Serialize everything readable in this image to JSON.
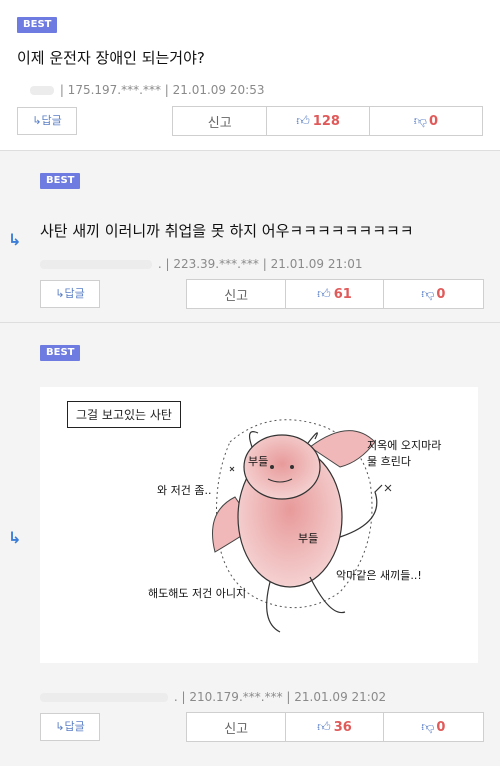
{
  "comments": [
    {
      "badge": "BEST",
      "text": "이제 운전자 장애인 되는거야?",
      "ip": "| 175.197.***.***",
      "datetime": "| 21.01.09 20:53",
      "reply_label": "↳답글",
      "report_label": "신고",
      "likes": "128",
      "dislikes": "0"
    },
    {
      "badge": "BEST",
      "text": "사탄 새끼 이러니까 취업을 못 하지 어우ㅋㅋㅋㅋㅋㅋㅋㅋㅋ",
      "ip": ". | 223.39.***.***",
      "datetime": "| 21.01.09 21:01",
      "reply_label": "↳답글",
      "report_label": "신고",
      "likes": "61",
      "dislikes": "0"
    },
    {
      "badge": "BEST",
      "image": {
        "caption": "그걸 보고있는 사탄",
        "texts": {
          "budeul1": "부들",
          "budeul2": "부들",
          "wajeogeon": "와 저건 좀..",
          "haedo": "해도해도 저건 아니지",
          "jiok": "지옥에 오지마라",
          "mul": "물 흐린다",
          "akma": "악마같은 새끼들..!"
        }
      },
      "ip": ". | 210.179.***.***",
      "datetime": "| 21.01.09 21:02",
      "reply_label": "↳답글",
      "report_label": "신고",
      "likes": "36",
      "dislikes": "0"
    }
  ],
  "reply_arrow": "↳",
  "icons": {
    "thumbs_up": "thumbs-up-icon",
    "thumbs_down": "thumbs-down-icon"
  },
  "colors": {
    "badge": "#6e7be0",
    "count": "#e05a5a",
    "icon": "#5a7fc6",
    "arrow": "#3b7dd8"
  }
}
